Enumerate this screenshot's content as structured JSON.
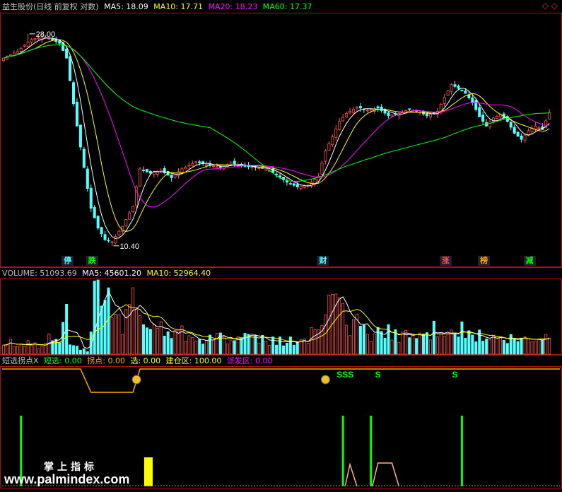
{
  "colors": {
    "up": "#ff5050",
    "down": "#54ffff",
    "ma5": "#ffffff",
    "ma10": "#ffff00",
    "ma20": "#ff00ff",
    "ma60": "#00ff00",
    "border": "#b01010",
    "orange": "#ffa500",
    "green": "#00ff00",
    "yellow": "#ffff00"
  },
  "header": {
    "title": "益生股份(日线 前复权 对数)",
    "ma5": "MA5: 18.09",
    "ma10": "MA10: 17.71",
    "ma20": "MA20: 18.23",
    "ma60": "MA60: 17.37",
    "corner": "◇ ◇"
  },
  "volume_header": {
    "volume": "VOLUME: 51093.69",
    "ma5": "MA5: 45601.20",
    "ma10": "MA10: 52964.40"
  },
  "indicator_header": {
    "name": "短选拐点X",
    "duanxuan": "短选: 0.00",
    "guaidian": "拐点: 0.00",
    "xuan": "选: 0.00",
    "jiancang": "建仓区: 100.00",
    "paifa": "派发区: 0.00"
  },
  "markers": [
    {
      "text": "停",
      "index": 18,
      "color": "#54ffff"
    },
    {
      "text": "跌",
      "index": 25,
      "color": "#00ff00"
    },
    {
      "text": "财",
      "index": 91,
      "color": "#54ffff"
    },
    {
      "text": "涨",
      "index": 126,
      "color": "#ff5050"
    },
    {
      "text": "榜",
      "index": 137,
      "color": "#ffa500"
    },
    {
      "text": "减",
      "index": 150,
      "color": "#00ff00"
    }
  ],
  "s_signals": [
    {
      "text": "SSS",
      "index": 96
    },
    {
      "text": "S",
      "index": 107
    },
    {
      "text": "S",
      "index": 129
    }
  ],
  "watermark": {
    "logo": "掌上指标",
    "url": "www.palmindex.com"
  },
  "chart_data": [
    {
      "type": "candlestick",
      "title": "益生股份(日线 前复权 对数)",
      "log_scale": true,
      "ylim": [
        9.6,
        30.5
      ],
      "bars": 157,
      "annotations": [
        {
          "text": "28.00",
          "index": 7,
          "value": 28.0,
          "label": "high"
        },
        {
          "text": "10.40",
          "index": 31,
          "value": 10.4,
          "label": "low"
        }
      ],
      "keypoints": [
        {
          "i": 0,
          "c": 25.0
        },
        {
          "i": 4,
          "c": 25.8
        },
        {
          "i": 8,
          "c": 27.3
        },
        {
          "i": 12,
          "c": 27.6
        },
        {
          "i": 16,
          "c": 26.8
        },
        {
          "i": 18,
          "c": 25.0
        },
        {
          "i": 19,
          "c": 22.5
        },
        {
          "i": 20,
          "c": 20.2
        },
        {
          "i": 21,
          "c": 18.2
        },
        {
          "i": 22,
          "c": 16.5
        },
        {
          "i": 23,
          "c": 15.0
        },
        {
          "i": 24,
          "c": 13.6
        },
        {
          "i": 25,
          "c": 12.4
        },
        {
          "i": 27,
          "c": 11.3
        },
        {
          "i": 29,
          "c": 10.7
        },
        {
          "i": 31,
          "c": 10.6
        },
        {
          "i": 34,
          "c": 11.4
        },
        {
          "i": 37,
          "c": 12.5
        },
        {
          "i": 39,
          "c": 14.9
        },
        {
          "i": 42,
          "c": 14.6
        },
        {
          "i": 45,
          "c": 14.8
        },
        {
          "i": 48,
          "c": 14.3
        },
        {
          "i": 51,
          "c": 14.9
        },
        {
          "i": 55,
          "c": 15.4
        },
        {
          "i": 58,
          "c": 15.2
        },
        {
          "i": 62,
          "c": 15.0
        },
        {
          "i": 65,
          "c": 15.3
        },
        {
          "i": 68,
          "c": 15.1
        },
        {
          "i": 72,
          "c": 15.0
        },
        {
          "i": 75,
          "c": 14.9
        },
        {
          "i": 78,
          "c": 14.5
        },
        {
          "i": 81,
          "c": 14.0
        },
        {
          "i": 84,
          "c": 13.7
        },
        {
          "i": 87,
          "c": 13.8
        },
        {
          "i": 90,
          "c": 14.4
        },
        {
          "i": 92,
          "c": 16.2
        },
        {
          "i": 94,
          "c": 17.3
        },
        {
          "i": 96,
          "c": 18.6
        },
        {
          "i": 98,
          "c": 19.3
        },
        {
          "i": 101,
          "c": 19.9
        },
        {
          "i": 104,
          "c": 19.6
        },
        {
          "i": 107,
          "c": 19.8
        },
        {
          "i": 110,
          "c": 19.1
        },
        {
          "i": 113,
          "c": 19.3
        },
        {
          "i": 116,
          "c": 19.7
        },
        {
          "i": 119,
          "c": 19.4
        },
        {
          "i": 121,
          "c": 19.1
        },
        {
          "i": 124,
          "c": 19.5
        },
        {
          "i": 126,
          "c": 20.8
        },
        {
          "i": 128,
          "c": 22.1
        },
        {
          "i": 130,
          "c": 21.7
        },
        {
          "i": 132,
          "c": 21.2
        },
        {
          "i": 134,
          "c": 20.3
        },
        {
          "i": 136,
          "c": 19.0
        },
        {
          "i": 138,
          "c": 18.2
        },
        {
          "i": 140,
          "c": 18.9
        },
        {
          "i": 142,
          "c": 19.2
        },
        {
          "i": 144,
          "c": 18.6
        },
        {
          "i": 146,
          "c": 17.6
        },
        {
          "i": 148,
          "c": 17.1
        },
        {
          "i": 150,
          "c": 17.8
        },
        {
          "i": 152,
          "c": 18.2
        },
        {
          "i": 154,
          "c": 17.9
        },
        {
          "i": 156,
          "c": 19.4
        }
      ]
    },
    {
      "type": "bar",
      "title": "VOLUME",
      "series": [
        {
          "name": "VOLUME",
          "value": 51093.69
        },
        {
          "name": "MA5",
          "value": 45601.2
        },
        {
          "name": "MA10",
          "value": 52964.4
        }
      ],
      "ylim": [
        0,
        235000
      ],
      "keypoints": [
        {
          "i": 0,
          "v": 40000
        },
        {
          "i": 10,
          "v": 26000
        },
        {
          "i": 17,
          "v": 70000
        },
        {
          "i": 18,
          "v": 110000
        },
        {
          "i": 19,
          "v": 26000
        },
        {
          "i": 24,
          "v": 9000
        },
        {
          "i": 27,
          "v": 235000
        },
        {
          "i": 29,
          "v": 190000
        },
        {
          "i": 31,
          "v": 140000
        },
        {
          "i": 34,
          "v": 100000
        },
        {
          "i": 37,
          "v": 150000
        },
        {
          "i": 39,
          "v": 125000
        },
        {
          "i": 42,
          "v": 90000
        },
        {
          "i": 48,
          "v": 75000
        },
        {
          "i": 55,
          "v": 60000
        },
        {
          "i": 62,
          "v": 52000
        },
        {
          "i": 70,
          "v": 45000
        },
        {
          "i": 78,
          "v": 42000
        },
        {
          "i": 85,
          "v": 37000
        },
        {
          "i": 90,
          "v": 90000
        },
        {
          "i": 93,
          "v": 145000
        },
        {
          "i": 96,
          "v": 130000
        },
        {
          "i": 99,
          "v": 100000
        },
        {
          "i": 103,
          "v": 75000
        },
        {
          "i": 108,
          "v": 60000
        },
        {
          "i": 112,
          "v": 72000
        },
        {
          "i": 116,
          "v": 55000
        },
        {
          "i": 121,
          "v": 60000
        },
        {
          "i": 126,
          "v": 100000
        },
        {
          "i": 130,
          "v": 75000
        },
        {
          "i": 134,
          "v": 62000
        },
        {
          "i": 138,
          "v": 48000
        },
        {
          "i": 144,
          "v": 45000
        },
        {
          "i": 150,
          "v": 41000
        },
        {
          "i": 156,
          "v": 51094
        }
      ]
    }
  ]
}
